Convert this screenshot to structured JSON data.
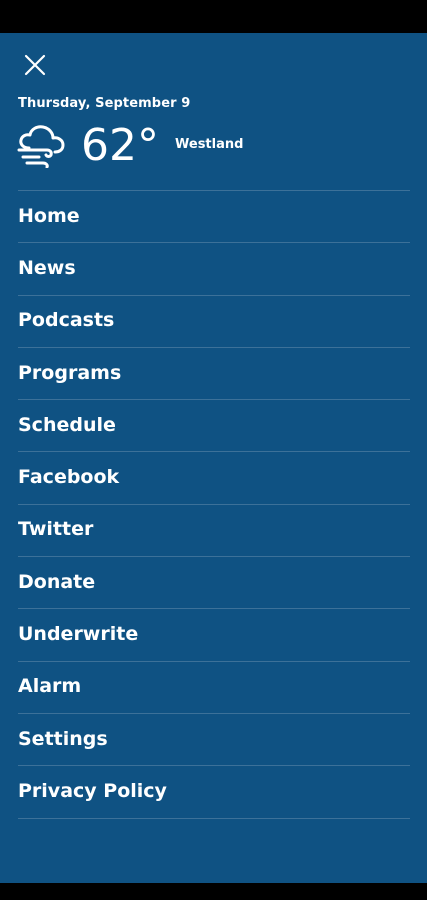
{
  "header": {
    "close_icon": "close-icon",
    "date": "Thursday, September 9",
    "weather_icon": "windy-cloud-icon",
    "temperature": "62°",
    "location": "Westland"
  },
  "menu": {
    "items": [
      {
        "label": "Home"
      },
      {
        "label": "News"
      },
      {
        "label": "Podcasts"
      },
      {
        "label": "Programs"
      },
      {
        "label": "Schedule"
      },
      {
        "label": "Facebook"
      },
      {
        "label": "Twitter"
      },
      {
        "label": "Donate"
      },
      {
        "label": "Underwrite"
      },
      {
        "label": "Alarm"
      },
      {
        "label": "Settings"
      },
      {
        "label": "Privacy Policy"
      }
    ]
  },
  "colors": {
    "drawer_background": "#0f5283",
    "divider": "#3c7199",
    "text": "#ffffff"
  }
}
